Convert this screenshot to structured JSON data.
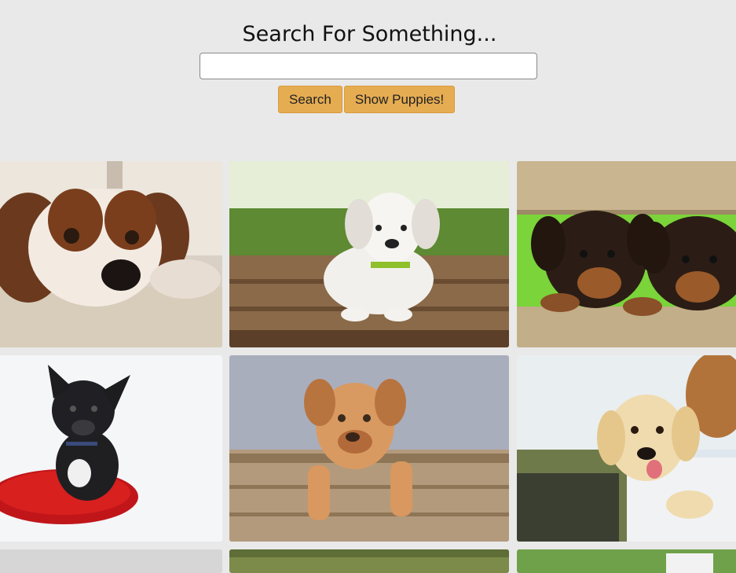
{
  "header": {
    "title": "Search For Something...",
    "search_value": "",
    "search_label": "Search",
    "puppies_label": "Show Puppies!"
  },
  "colors": {
    "background": "#e9e9e9",
    "button": "#e6ac52"
  },
  "images": [
    {
      "subject": "cavalier-spaniel-lying-on-rug"
    },
    {
      "subject": "white-labrador-puppy-on-deck"
    },
    {
      "subject": "two-rottweiler-puppies-over-fence"
    },
    {
      "subject": "french-bulldog-on-red-cushion"
    },
    {
      "subject": "mastiff-puppy-in-wooden-crate"
    },
    {
      "subject": "golden-retriever-puppy-on-shoulder"
    },
    {
      "subject": "puppy-photo-partially-visible"
    },
    {
      "subject": "puppy-photo-partially-visible"
    },
    {
      "subject": "puppy-photo-partially-visible"
    }
  ]
}
